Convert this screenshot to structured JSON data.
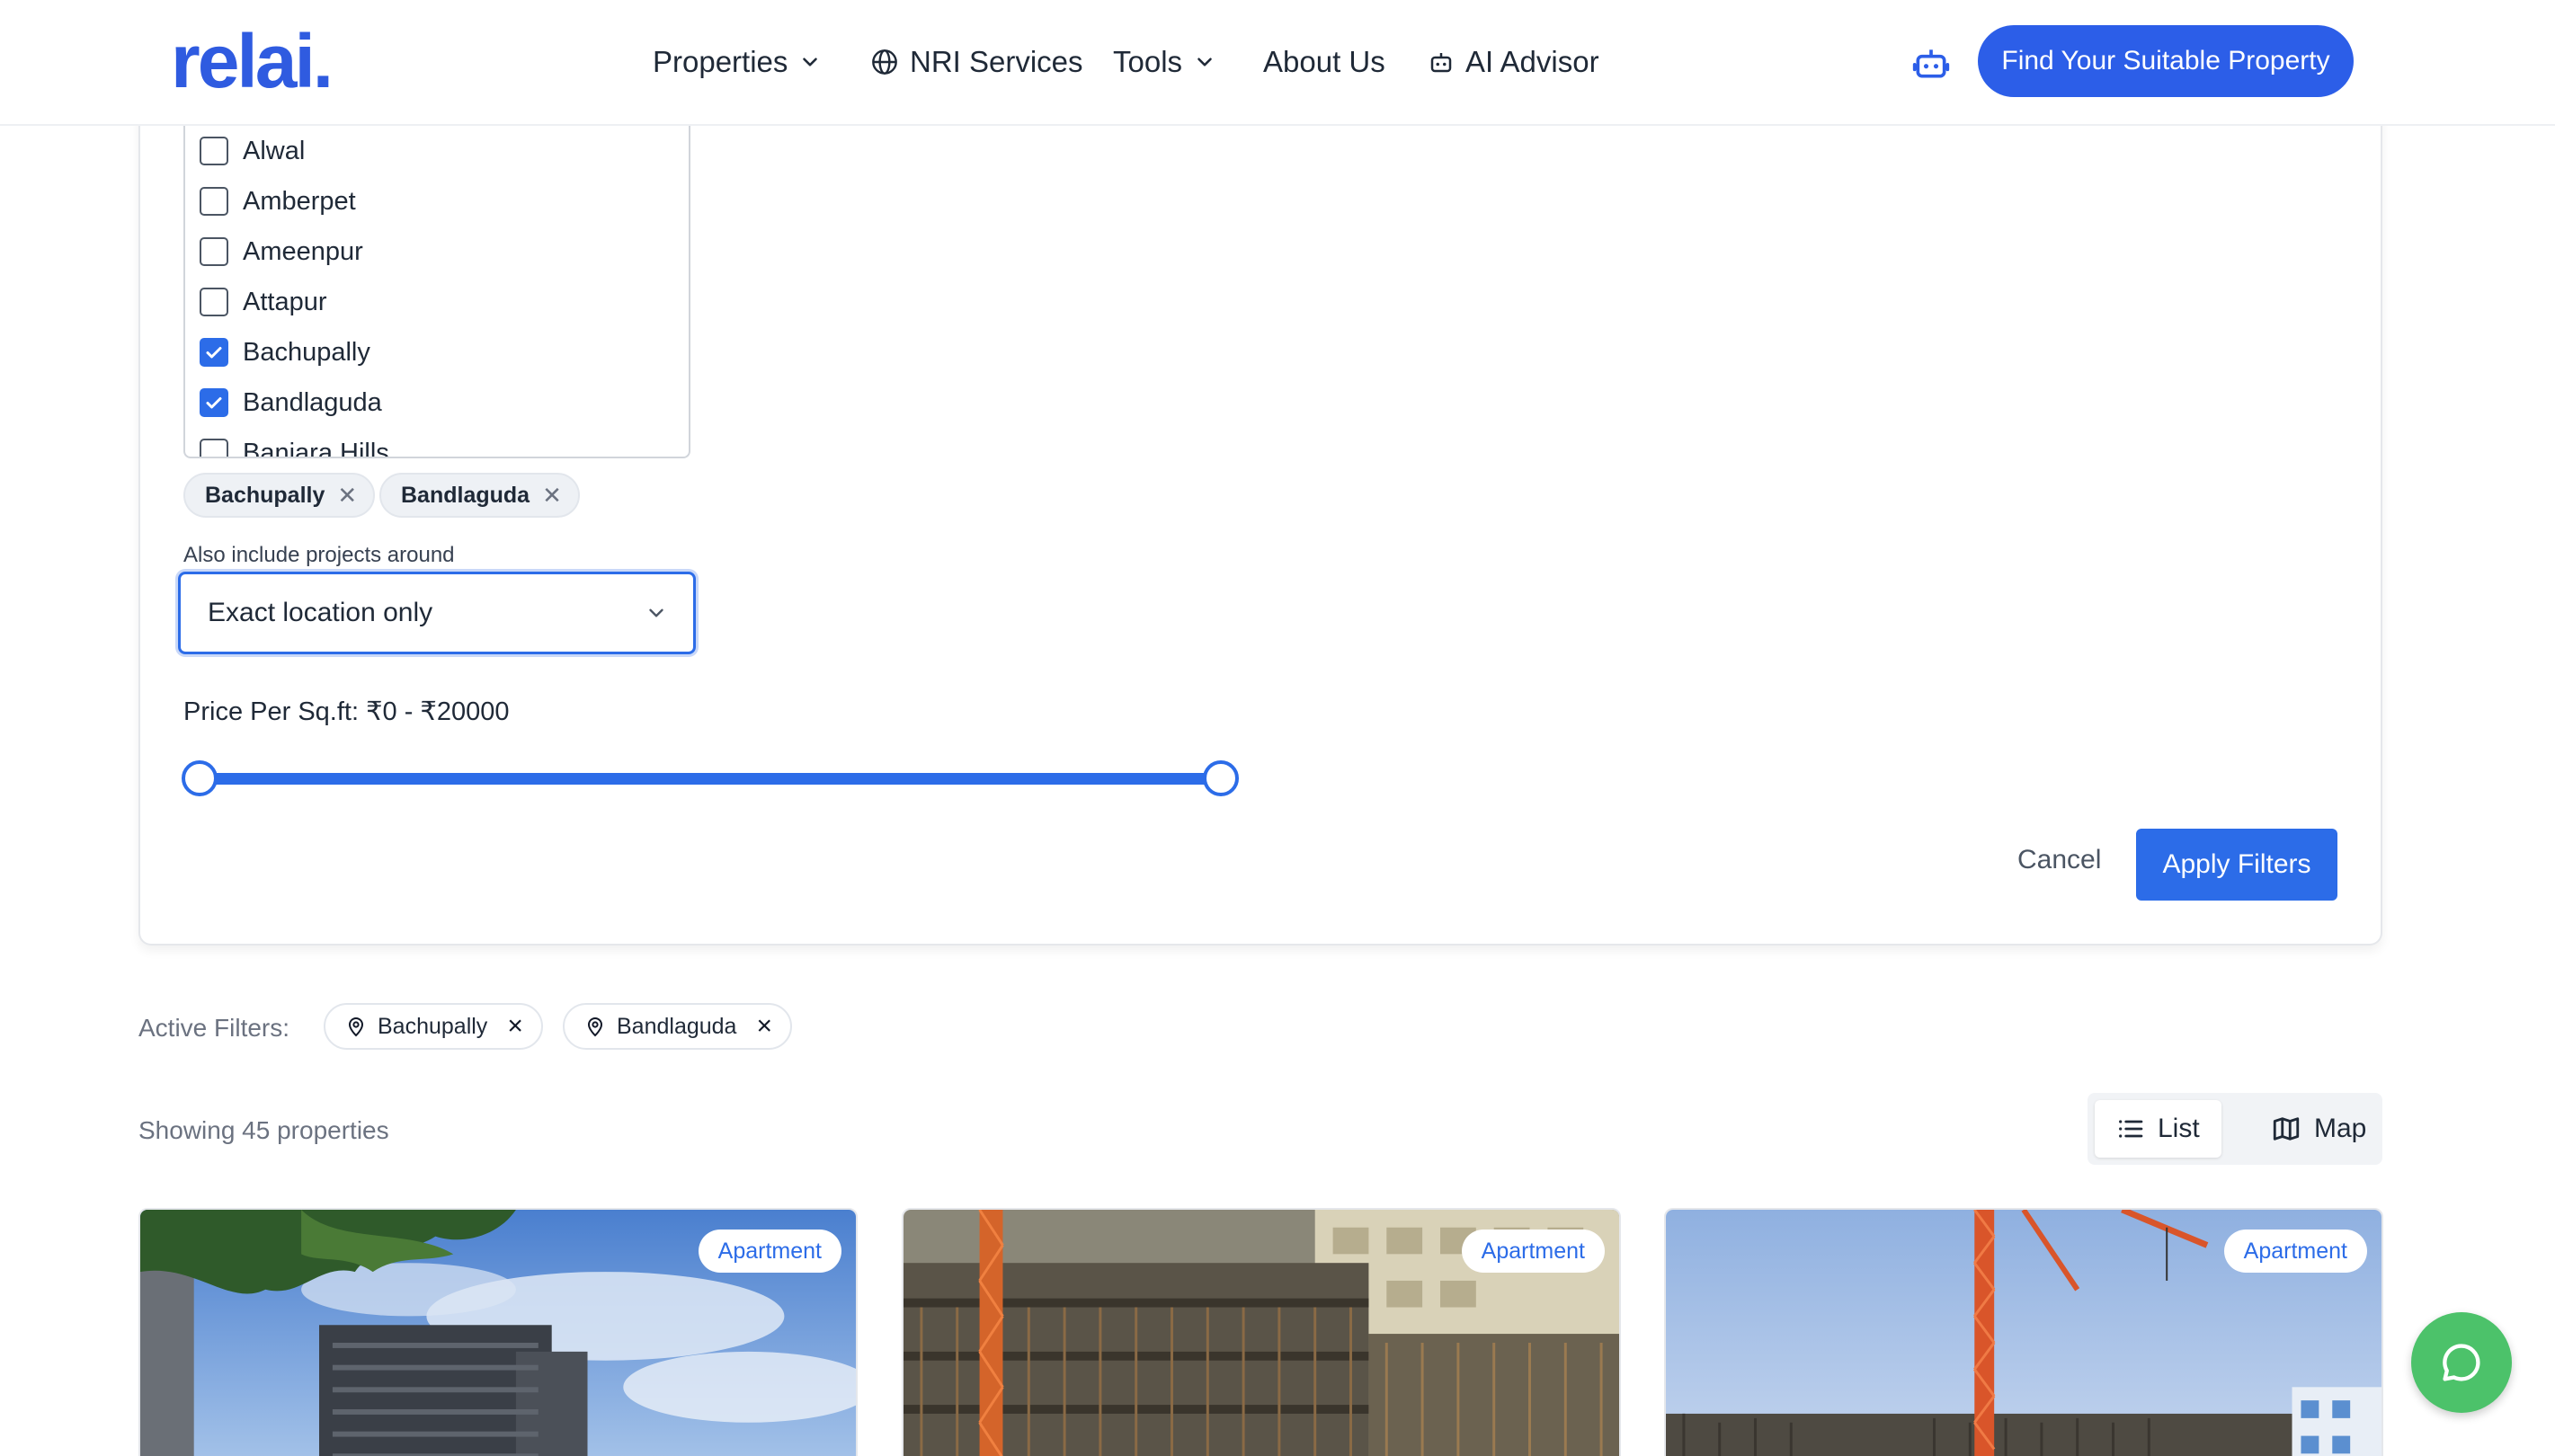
{
  "header": {
    "logo": "relai.",
    "nav": {
      "properties": "Properties",
      "nri_services": "NRI Services",
      "tools": "Tools",
      "about_us": "About Us",
      "ai_advisor": "AI Advisor"
    },
    "cta_label": "Find Your Suitable Property"
  },
  "filters": {
    "locations": [
      {
        "label": "Alwal",
        "checked": false
      },
      {
        "label": "Amberpet",
        "checked": false
      },
      {
        "label": "Ameenpur",
        "checked": false
      },
      {
        "label": "Attapur",
        "checked": false
      },
      {
        "label": "Bachupally",
        "checked": true
      },
      {
        "label": "Bandlaguda",
        "checked": true
      },
      {
        "label": "Banjara Hills",
        "checked": false
      }
    ],
    "selected_chips": [
      "Bachupally",
      "Bandlaguda"
    ],
    "around_label": "Also include projects around",
    "around_value": "Exact location only",
    "price_label": "Price Per Sq.ft: ₹0 - ₹20000",
    "price_range": {
      "min": 0,
      "max": 20000,
      "selected_min": 0,
      "selected_max": 20000
    },
    "cancel_label": "Cancel",
    "apply_label": "Apply Filters"
  },
  "active_filters": {
    "label": "Active Filters:",
    "items": [
      "Bachupally",
      "Bandlaguda"
    ]
  },
  "results": {
    "showing_text": "Showing 45 properties",
    "view_list": "List",
    "view_map": "Map",
    "cards": [
      {
        "tag": "Apartment"
      },
      {
        "tag": "Apartment"
      },
      {
        "tag": "Apartment"
      }
    ]
  },
  "colors": {
    "brand": "#2f5be0",
    "accent": "#2c6ce8",
    "chat": "#4cc26a"
  }
}
